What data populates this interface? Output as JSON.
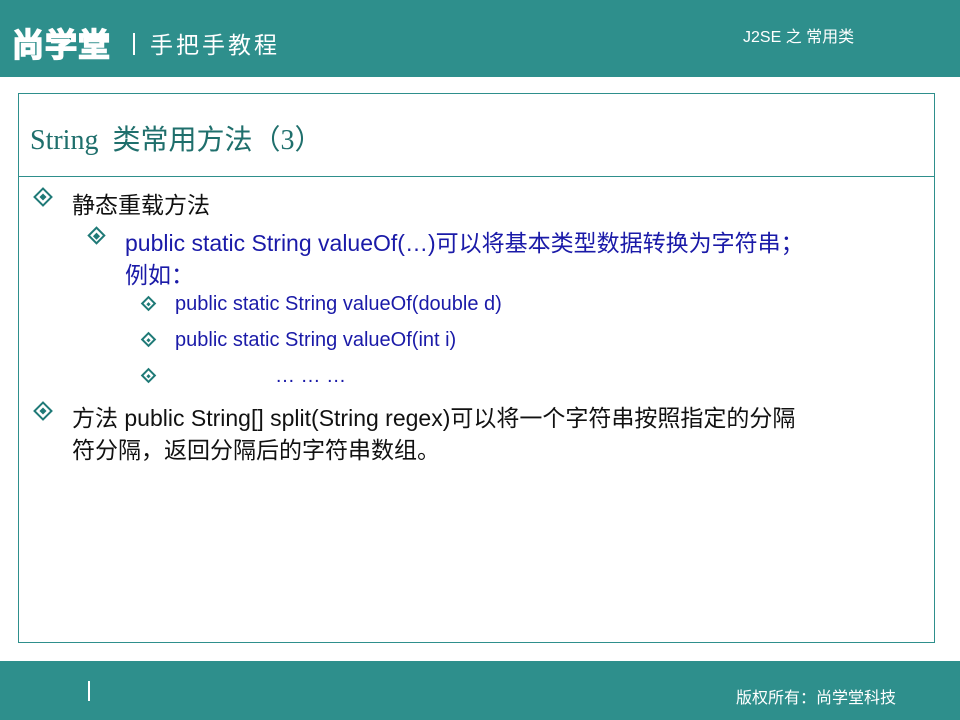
{
  "header": {
    "logo_text": "尚学堂",
    "tagline": "手把手教程",
    "course": "J2SE 之 常用类"
  },
  "slide": {
    "title": "String  类常用方法（3）",
    "items": [
      {
        "level": 1,
        "text": "静态重载方法"
      },
      {
        "level": 2,
        "line1": "public static String valueOf(…)可以将基本类型数据转换为字符串；",
        "line2": "例如："
      },
      {
        "level": 3,
        "text": "public static String valueOf(double d)"
      },
      {
        "level": 3,
        "text": "public static String valueOf(int i)"
      },
      {
        "level": 3,
        "text": "… … …"
      },
      {
        "level": 1,
        "line1": "方法 public String[] split(String regex)可以将一个字符串按照指定的分隔",
        "line2": "符分隔，返回分隔后的字符串数组。"
      }
    ]
  },
  "footer": {
    "copyright": "版权所有：尚学堂科技"
  },
  "colors": {
    "brand": "#2e8f8c",
    "level2_text": "#1a1aa8",
    "level1_text": "#111111"
  }
}
